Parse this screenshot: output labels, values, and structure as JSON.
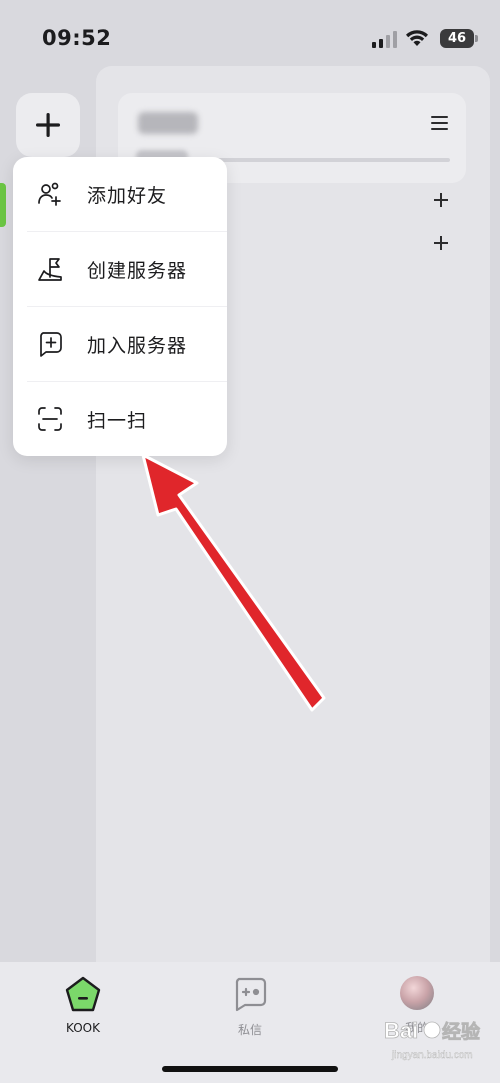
{
  "status_bar": {
    "time": "09:52",
    "battery": "46"
  },
  "popup_menu": {
    "items": [
      {
        "label": "添加好友",
        "icon": "add-friend-icon"
      },
      {
        "label": "创建服务器",
        "icon": "create-server-icon"
      },
      {
        "label": "加入服务器",
        "icon": "join-server-icon"
      },
      {
        "label": "扫一扫",
        "icon": "scan-icon"
      }
    ]
  },
  "header": {
    "menu_icon": "hamburger-icon"
  },
  "tab_bar": {
    "tabs": [
      {
        "label": "KOOK",
        "icon": "kook-icon",
        "active": true
      },
      {
        "label": "私信",
        "icon": "gamepad-chat-icon",
        "active": false
      },
      {
        "label": "我的",
        "icon": "avatar",
        "active": false
      }
    ]
  },
  "watermark": {
    "line1": "Bai",
    "line2": "经验",
    "sub": "jingyan.baidu.com"
  },
  "colors": {
    "accent_green": "#6cc644",
    "arrow_red": "#e0262b"
  }
}
